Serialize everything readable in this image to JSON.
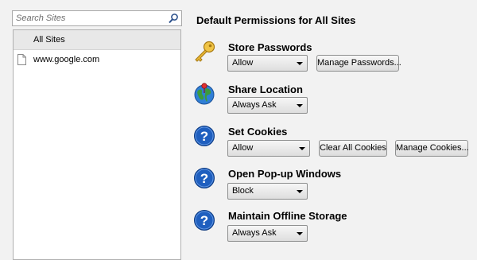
{
  "search": {
    "placeholder": "Search Sites",
    "value": ""
  },
  "sites": {
    "all_label": "All Sites",
    "items": [
      {
        "label": "www.google.com"
      }
    ]
  },
  "main": {
    "title": "Default Permissions for All Sites",
    "permissions": [
      {
        "label": "Store Passwords",
        "icon": "key-icon",
        "value": "Allow",
        "buttons": [
          "Manage Passwords..."
        ]
      },
      {
        "label": "Share Location",
        "icon": "globe-icon",
        "value": "Always Ask",
        "buttons": []
      },
      {
        "label": "Set Cookies",
        "icon": "help-icon",
        "value": "Allow",
        "buttons": [
          "Clear All Cookies",
          "Manage Cookies..."
        ]
      },
      {
        "label": "Open Pop-up Windows",
        "icon": "help-icon",
        "value": "Block",
        "buttons": []
      },
      {
        "label": "Maintain Offline Storage",
        "icon": "help-icon",
        "value": "Always Ask",
        "buttons": []
      }
    ]
  },
  "colors": {
    "help_blue": "#1f5fbf",
    "key_gold": "#e8b634",
    "globe_green": "#3c9b3c"
  }
}
